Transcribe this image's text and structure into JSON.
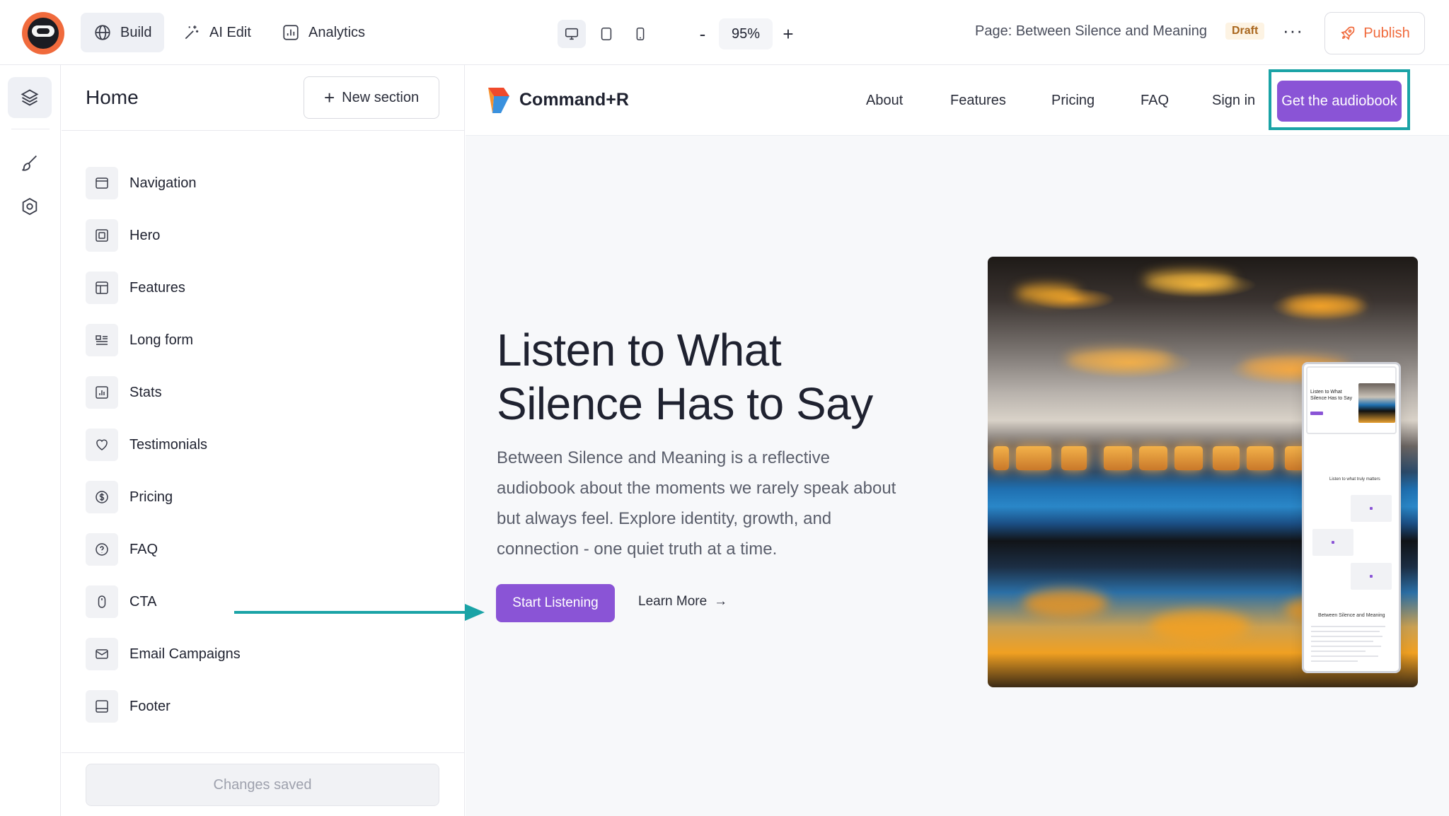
{
  "topbar": {
    "tabs": [
      {
        "label": "Build",
        "icon": "globe-icon",
        "active": true
      },
      {
        "label": "AI Edit",
        "icon": "sparkle-wand-icon",
        "active": false
      },
      {
        "label": "Analytics",
        "icon": "bar-chart-icon",
        "active": false
      }
    ],
    "devices": [
      "desktop-icon",
      "tablet-icon",
      "mobile-icon"
    ],
    "zoom": {
      "minus": "-",
      "value": "95%",
      "plus": "+"
    },
    "page_label": "Page: Between Silence and Meaning",
    "status_badge": "Draft",
    "more": "···",
    "publish_label": "Publish"
  },
  "rail": {
    "items": [
      "layers-icon",
      "brush-icon",
      "settings-icon"
    ]
  },
  "panel": {
    "title": "Home",
    "new_section_label": "New section",
    "sections": [
      {
        "label": "Navigation",
        "icon": "navigation-window-icon"
      },
      {
        "label": "Hero",
        "icon": "hero-frame-icon"
      },
      {
        "label": "Features",
        "icon": "features-layout-icon"
      },
      {
        "label": "Long form",
        "icon": "long-form-icon"
      },
      {
        "label": "Stats",
        "icon": "stats-chart-icon"
      },
      {
        "label": "Testimonials",
        "icon": "heart-icon"
      },
      {
        "label": "Pricing",
        "icon": "dollar-circle-icon"
      },
      {
        "label": "FAQ",
        "icon": "question-circle-icon"
      },
      {
        "label": "CTA",
        "icon": "mouse-icon"
      },
      {
        "label": "Email Campaigns",
        "icon": "mail-icon"
      },
      {
        "label": "Footer",
        "icon": "footer-layout-icon"
      }
    ],
    "status": "Changes saved"
  },
  "preview": {
    "brand": "Command+R",
    "nav_links": [
      "About",
      "Features",
      "Pricing",
      "FAQ",
      "Sign in"
    ],
    "nav_cta": "Get the audiobook",
    "hero": {
      "title_line1": "Listen to What",
      "title_line2": "Silence Has to Say",
      "subtitle": "Between Silence and Meaning is a reflective audiobook about the moments we rarely speak about but always feel. Explore identity, growth, and connection - one quiet truth at a time.",
      "primary_cta": "Start Listening",
      "secondary_cta": "Learn More",
      "secondary_arrow": "→"
    },
    "mini_preview": {
      "hero_title": "Listen to What Silence Has to Say",
      "section_title": "Listen to what truly matters",
      "long_form_title": "Between Silence and Meaning"
    }
  },
  "colors": {
    "accent_purple": "#8a54d6",
    "publish_orange": "#f06a3c",
    "highlight_teal": "#1aa3a6",
    "draft_text": "#a9661d"
  }
}
